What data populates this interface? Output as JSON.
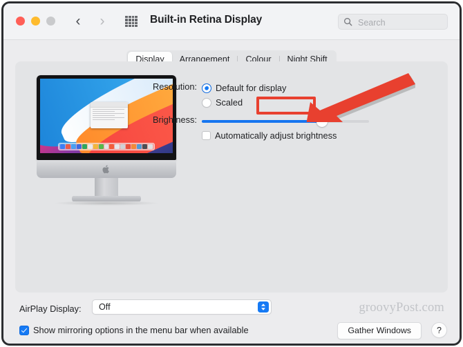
{
  "window": {
    "title": "Built-in Retina Display",
    "traffic_lights": [
      "close",
      "minimize",
      "zoom"
    ],
    "nav_back_icon": "chevron-left-icon",
    "nav_forward_icon": "chevron-right-icon",
    "grid_icon": "show-all-grid-icon",
    "colors": {
      "titlebar_bg": "#f2f3f5",
      "window_bg": "#ececee",
      "panel_bg": "#e3e4e6",
      "accent_blue": "#167af4",
      "annotation_red": "#e8402f",
      "close_red": "#ff5f57",
      "minimize_yellow": "#febb2e",
      "zoom_grey": "#c9cacc"
    }
  },
  "search": {
    "placeholder": "Search",
    "value": "",
    "icon": "search-icon"
  },
  "tabs": [
    {
      "label": "Display",
      "active": true
    },
    {
      "label": "Arrangement",
      "active": false
    },
    {
      "label": "Colour",
      "active": false
    },
    {
      "label": "Night Shift",
      "active": false
    }
  ],
  "preview": {
    "device": "iMac",
    "wallpaper": "macOS Big Sur",
    "apple_logo_icon": "apple-logo-icon"
  },
  "controls": {
    "resolution": {
      "label": "Resolution:",
      "options": [
        {
          "label": "Default for display",
          "selected": true
        },
        {
          "label": "Scaled",
          "selected": false
        }
      ]
    },
    "brightness": {
      "label": "Brightness:",
      "value_percent": 72
    },
    "auto_brightness": {
      "label": "Automatically adjust brightness",
      "checked": false
    }
  },
  "annotation": {
    "highlight_target": "Scaled",
    "arrow_direction": "down-left",
    "color": "#e8402f"
  },
  "bottom": {
    "airplay_label": "AirPlay Display:",
    "airplay_value": "Off",
    "airplay_stepper_icon": "stepper-up-down-icon",
    "mirroring_label": "Show mirroring options in the menu bar when available",
    "mirroring_checked": true,
    "gather_windows_label": "Gather Windows",
    "help_label": "?",
    "watermark": "groovyPost.com"
  }
}
